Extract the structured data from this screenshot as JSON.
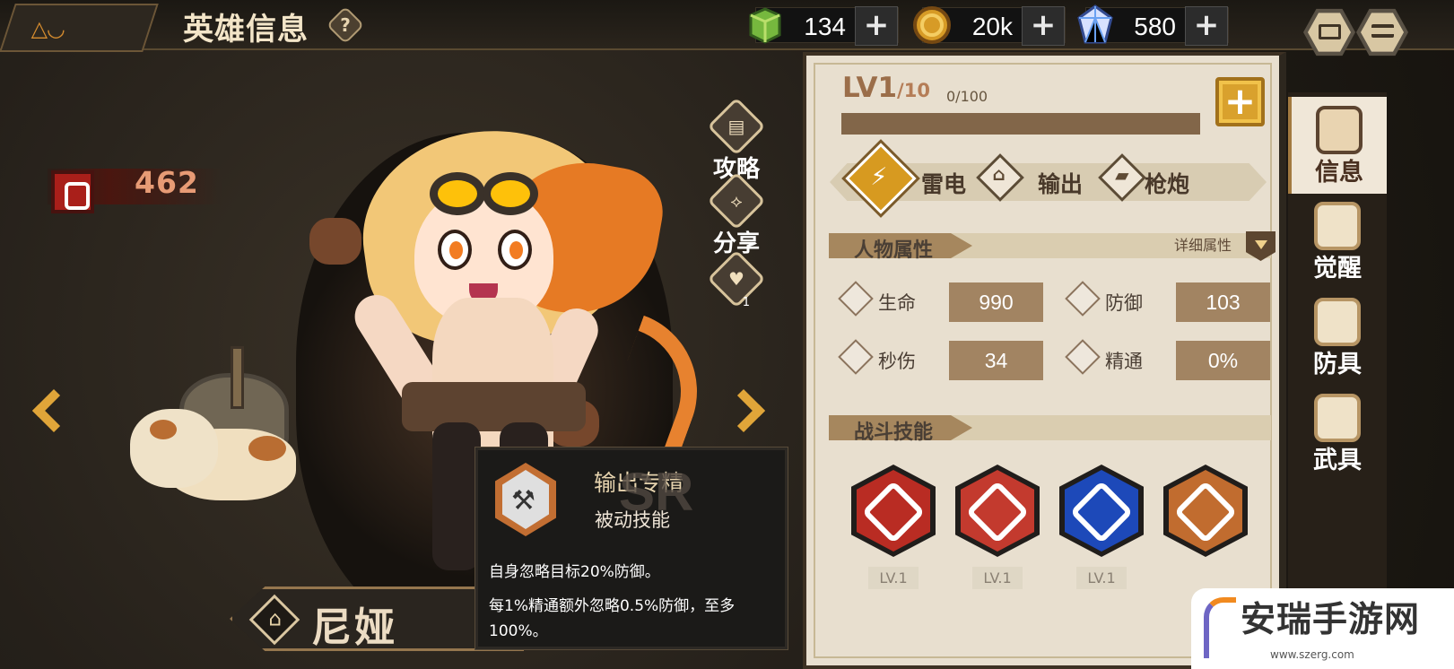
{
  "header": {
    "logo": "△◡",
    "title": "英雄信息",
    "help": "?"
  },
  "resources": [
    {
      "name": "green-cube",
      "value": "134",
      "color": "#6fb32d"
    },
    {
      "name": "gold-coin",
      "value": "20k",
      "color": "#d59b28"
    },
    {
      "name": "crystal",
      "value": "580",
      "color": "#7b9de5"
    }
  ],
  "power": {
    "value": "462"
  },
  "actions": {
    "guide": "攻略",
    "share": "分享",
    "favorite_count": "1"
  },
  "hero": {
    "name": "尼娅"
  },
  "tooltip": {
    "title": "输出专精",
    "subtitle": "被动技能",
    "rarity": "SR",
    "desc": [
      "自身忽略目标20%防御。",
      "每1%精通额外忽略0.5%防御，至多100%。"
    ]
  },
  "level": {
    "current": "LV1",
    "max": "/10",
    "exp": "0/100"
  },
  "tags": [
    "雷电",
    "输出",
    "枪炮"
  ],
  "attributes": {
    "title": "人物属性",
    "detail": "详细属性",
    "items": [
      {
        "name": "生命",
        "value": "990"
      },
      {
        "name": "防御",
        "value": "103"
      },
      {
        "name": "秒伤",
        "value": "34"
      },
      {
        "name": "精通",
        "value": "0%"
      }
    ]
  },
  "skills": {
    "title": "战斗技能",
    "items": [
      {
        "level": "LV.1",
        "color": "#b92c23"
      },
      {
        "level": "LV.1",
        "color": "#c33a2e"
      },
      {
        "level": "LV.1",
        "color": "#1d49b9"
      },
      {
        "level": "",
        "color": "#c16c2f"
      }
    ]
  },
  "nav": [
    "信息",
    "觉醒",
    "防具",
    "武具"
  ],
  "watermark": {
    "name": "安瑞手游网",
    "url": "www.szerg.com"
  }
}
